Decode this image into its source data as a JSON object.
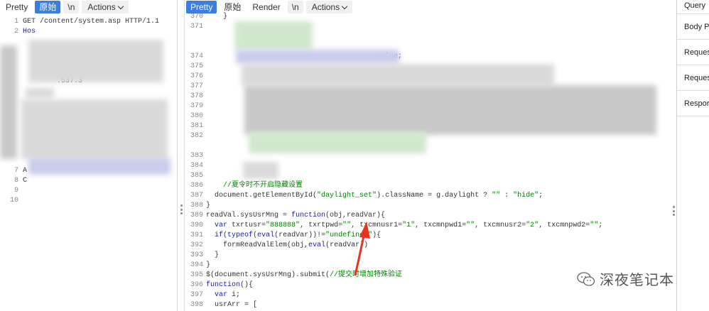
{
  "left_toolbar": {
    "pretty": "Pretty",
    "raw": "原始",
    "newline": "\\n",
    "actions": "Actions"
  },
  "mid_toolbar": {
    "pretty": "Pretty",
    "raw": "原始",
    "render": "Render",
    "newline": "\\n",
    "actions": "Actions"
  },
  "request_lines": [
    {
      "n": "1",
      "t": "GET /content/system.asp HTTP/1.1"
    },
    {
      "n": "2",
      "t": "Hos"
    },
    {
      "n": "",
      "t": ""
    },
    {
      "n": "",
      "t": ""
    },
    {
      "n": "",
      "t": ""
    },
    {
      "n": "",
      "t": ""
    },
    {
      "n": "",
      "t": "        .537.3"
    },
    {
      "n": "",
      "t": ""
    },
    {
      "n": "",
      "t": ""
    },
    {
      "n": "",
      "t": ""
    },
    {
      "n": "",
      "t": ""
    },
    {
      "n": "",
      "t": ""
    },
    {
      "n": "",
      "t": ""
    },
    {
      "n": "",
      "t": ""
    },
    {
      "n": "",
      "t": ""
    },
    {
      "n": "7",
      "t": "A"
    },
    {
      "n": "8",
      "t": "C"
    },
    {
      "n": "9",
      "t": ""
    },
    {
      "n": "10",
      "t": ""
    }
  ],
  "response_lines": [
    {
      "n": "370",
      "t": "    }"
    },
    {
      "n": "371",
      "t": ""
    },
    {
      "n": "",
      "t": ""
    },
    {
      "n": "",
      "t": ""
    },
    {
      "n": "374",
      "t": "                                       .value;"
    },
    {
      "n": "375",
      "t": ""
    },
    {
      "n": "376",
      "t": ""
    },
    {
      "n": "377",
      "t": ""
    },
    {
      "n": "378",
      "t": ""
    },
    {
      "n": "379",
      "t": ""
    },
    {
      "n": "380",
      "t": ""
    },
    {
      "n": "381",
      "t": ""
    },
    {
      "n": "382",
      "t": ""
    },
    {
      "n": "",
      "t": ""
    },
    {
      "n": "383",
      "t": ""
    },
    {
      "n": "384",
      "t": ""
    },
    {
      "n": "385",
      "t": ""
    }
  ],
  "code": {
    "l386_n": "386",
    "l386_comment": "//夏令时不开启隐藏设置",
    "l387_n": "387",
    "l387_a": "document.getElementById(",
    "l387_s1": "\"daylight_set\"",
    "l387_b": ").className = g.daylight ? ",
    "l387_s2": "\"\"",
    "l387_c": " : ",
    "l387_s3": "\"hide\"",
    "l387_d": ";",
    "l388_n": "388",
    "l388_t": "}",
    "l389_n": "389",
    "l389_a": "readVal.sysUsrMng = ",
    "l389_kw": "function",
    "l389_b": "(obj,readVar){",
    "l390_n": "390",
    "l390_kw": "var",
    "l390_a": " txrtusr=",
    "l390_s1": "\"888888\"",
    "l390_b": ", txrtpwd=",
    "l390_s2": "\"\"",
    "l390_c": ", txcmnusr1=",
    "l390_s3": "\"1\"",
    "l390_d": ", txcmnpwd1=",
    "l390_s4": "\"\"",
    "l390_e": ", txcmnusr2=",
    "l390_s5": "\"2\"",
    "l390_f": ", txcmnpwd2=",
    "l390_s6": "\"\"",
    "l390_g": ";",
    "l391_n": "391",
    "l391_kw1": "if",
    "l391_a": "(",
    "l391_kw2": "typeof",
    "l391_b": "(",
    "l391_kw3": "eval",
    "l391_c": "(readVar))!=",
    "l391_s": "\"undefined\"",
    "l391_d": "){",
    "l392_n": "392",
    "l392_a": "formReadValElem(obj,",
    "l392_kw": "eval",
    "l392_b": "(readVar))",
    "l393_n": "393",
    "l393_t": "}",
    "l394_n": "394",
    "l394_t": "}",
    "l395_n": "395",
    "l395_a": "$(document.sysUsrMng).submit(",
    "l395_cm": "//提交时增加特殊验证",
    "l396_n": "396",
    "l396_kw": "function",
    "l396_a": "(){",
    "l397_n": "397",
    "l397_kw": "var",
    "l397_a": " i;",
    "l398_n": "398",
    "l398_a": "usrArr = ["
  },
  "right_tabs": [
    "Query",
    "Body P",
    "Reques",
    "Reques",
    "Respor"
  ],
  "watermark": {
    "text": "深夜笔记本",
    "icon": "wechat-icon"
  },
  "colors": {
    "accent": "#3b7ee0",
    "keyword": "#1a1aa6",
    "string": "#008000",
    "arrow": "#e8311f"
  }
}
